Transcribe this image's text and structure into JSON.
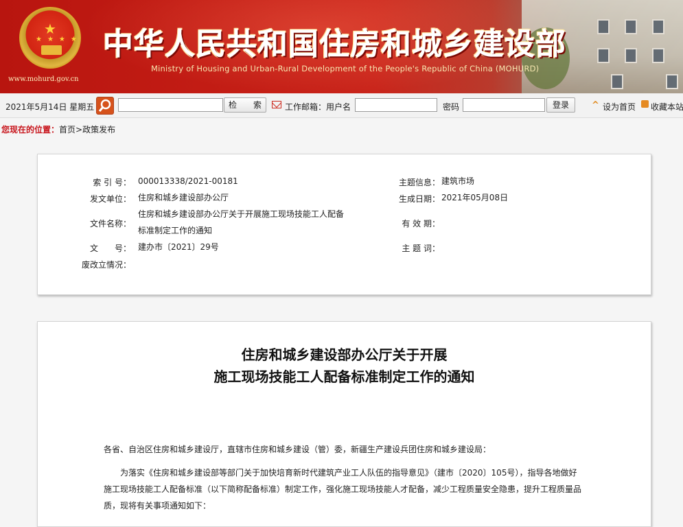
{
  "header": {
    "title_cn": "中华人民共和国住房和城乡建设部",
    "title_en": "Ministry of Housing and Urban-Rural Development of the People's Republic of China (MOHURD)",
    "site_url": "www.mohurd.gov.cn"
  },
  "toolbar": {
    "date": "2021年5月14日  星期五",
    "search_value": "",
    "search_button": "检　　索",
    "mail_label": "工作邮箱：用户名",
    "username_value": "",
    "password_label": "密码",
    "password_value": "",
    "login_button": "登录",
    "set_home": "设为首页",
    "bookmark": "收藏本站"
  },
  "breadcrumb": {
    "label": "您现在的位置：",
    "home": "首页",
    "separator": ">",
    "current": "政策发布"
  },
  "info": {
    "index_label": "索 引 号：",
    "index_value": "000013338/2021-00181",
    "topic_label": "主题信息：",
    "topic_value": "建筑市场",
    "issuer_label": "发文单位：",
    "issuer_value": "住房和城乡建设部办公厅",
    "date_label": "生成日期：",
    "date_value": "2021年05月08日",
    "name_label": "文件名称：",
    "name_value_1": "住房和城乡建设部办公厅关于开展施工现场技能工人配备",
    "name_value_2": "标准制定工作的通知",
    "validity_label": "有 效 期：",
    "validity_value": "",
    "docno_label": "文　　号：",
    "docno_value": "建办市〔2021〕29号",
    "keywords_label": "主 题 词：",
    "keywords_value": "",
    "revision_label": "废改立情况：",
    "revision_value": ""
  },
  "article": {
    "title_line1": "住房和城乡建设部办公厅关于开展",
    "title_line2": "施工现场技能工人配备标准制定工作的通知",
    "salutation": "各省、自治区住房和城乡建设厅，直辖市住房和城乡建设（管）委，新疆生产建设兵团住房和城乡建设局：",
    "para1_line1": "　　为落实《住房和城乡建设部等部门关于加快培育新时代建筑产业工人队伍的指导意见》（建市〔2020〕105号），指导各地做好",
    "para1_line2": "施工现场技能工人配备标准（以下简称配备标准）制定工作，强化施工现场技能人才配备，减少工程质量安全隐患，提升工程质量品",
    "para1_line3": "质，现将有关事项通知如下："
  },
  "colors": {
    "banner_red": "#c21c14",
    "breadcrumb_red": "#c8161d",
    "search_orange": "#d6521b"
  }
}
